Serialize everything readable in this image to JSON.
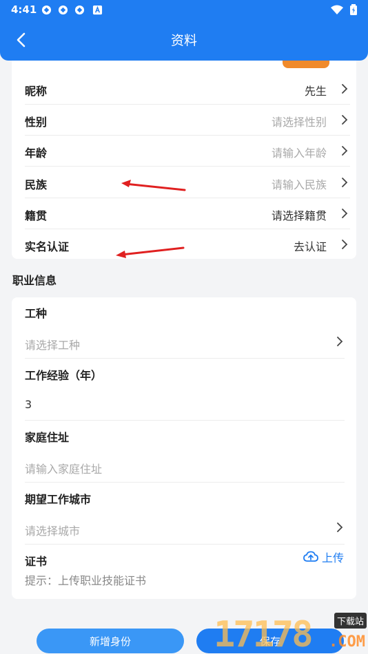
{
  "status_bar": {
    "time": "4:41"
  },
  "header": {
    "title": "资料"
  },
  "basic_info": {
    "rows": [
      {
        "label": "昵称",
        "value": "先生",
        "is_placeholder": false
      },
      {
        "label": "性别",
        "value": "请选择性别",
        "is_placeholder": true
      },
      {
        "label": "年龄",
        "value": "请输入年龄",
        "is_placeholder": true
      },
      {
        "label": "民族",
        "value": "请输入民族",
        "is_placeholder": true
      },
      {
        "label": "籍贯",
        "value": "请选择籍贯",
        "is_placeholder": false
      },
      {
        "label": "实名认证",
        "value": "去认证",
        "is_placeholder": false
      }
    ]
  },
  "career": {
    "section_title": "职业信息",
    "job_type": {
      "label": "工种",
      "placeholder": "请选择工种"
    },
    "experience": {
      "label": "工作经验（年）",
      "value": "3"
    },
    "address": {
      "label": "家庭住址",
      "placeholder": "请输入家庭住址"
    },
    "city": {
      "label": "期望工作城市",
      "placeholder": "请选择城市"
    },
    "certificate": {
      "label": "证书",
      "hint": "提示：上传职业技能证书",
      "upload_label": "上传"
    }
  },
  "footer": {
    "add_identity_label": "新增身份",
    "save_label": "保存"
  },
  "watermark": {
    "digits": "17178",
    "badge": "下载站",
    "suffix": ".COM"
  },
  "colors": {
    "primary": "#1f7df2",
    "secondary_button": "#3a97f6",
    "annotation_arrow": "#e02020"
  }
}
